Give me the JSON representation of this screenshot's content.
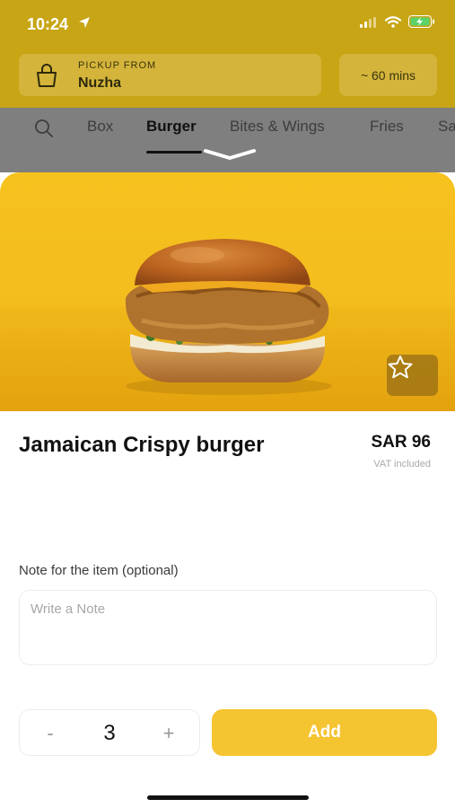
{
  "status_bar": {
    "time": "10:24"
  },
  "pickup": {
    "label": "PICKUP FROM",
    "value": "Nuzha"
  },
  "eta": "~ 60 mins",
  "categories": [
    "Box",
    "Burger",
    "Bites & Wings",
    "Fries",
    "Sa"
  ],
  "active_category": "Burger",
  "item": {
    "name": "Jamaican Crispy burger",
    "price": "SAR 96",
    "vat_note": "VAT included"
  },
  "note": {
    "label": "Note for the item (optional)",
    "placeholder": "Write a Note",
    "value": ""
  },
  "quantity": {
    "minus": "-",
    "value": "3",
    "plus": "+"
  },
  "add_button": "Add",
  "colors": {
    "accent": "#f5c431",
    "hero_bg": "#f6c21e"
  }
}
